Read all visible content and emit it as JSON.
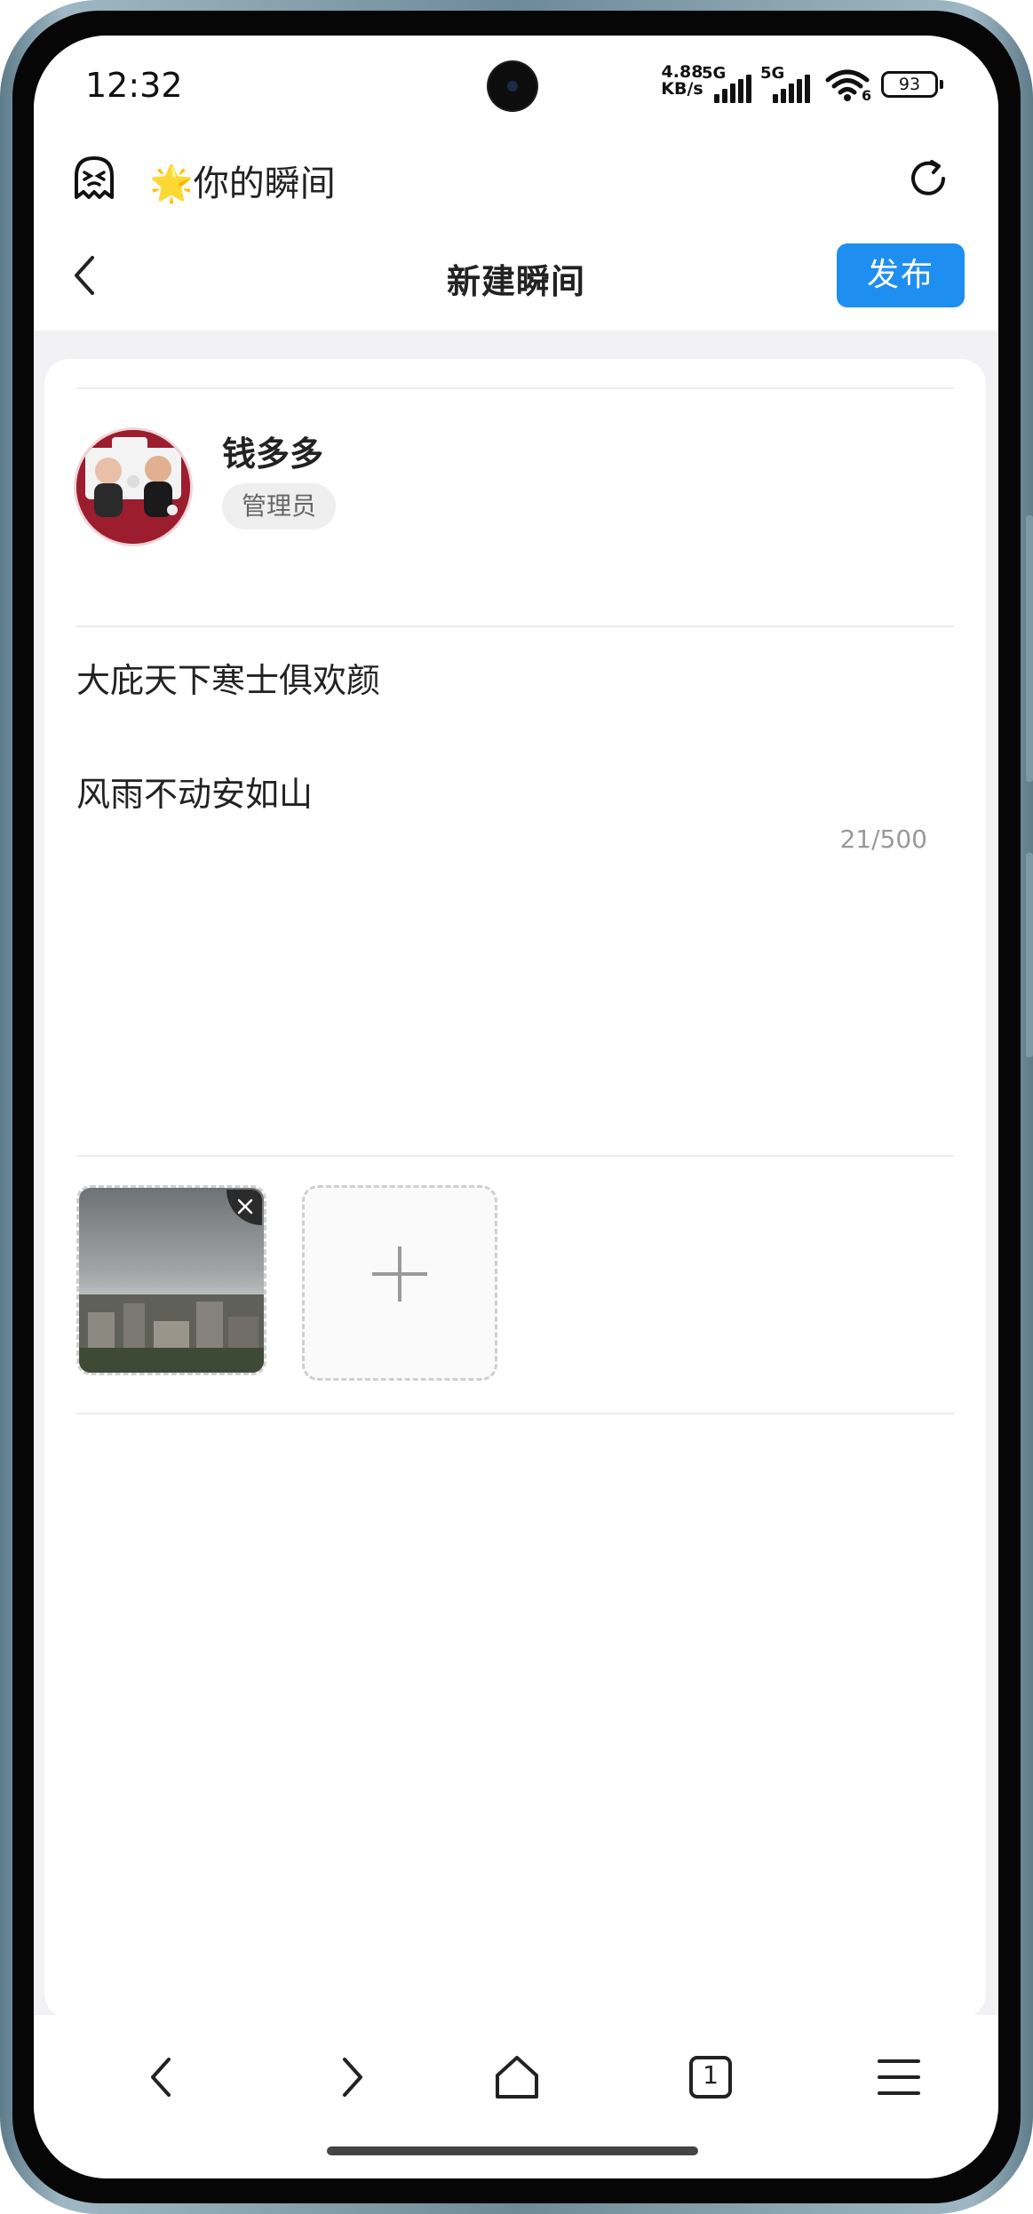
{
  "status_bar": {
    "time": "12:32",
    "net_speed_value": "4.88",
    "net_speed_unit": "KB/s",
    "signal_1_label": "5G",
    "signal_2_label": "5G",
    "wifi_badge": "6",
    "battery": "93"
  },
  "browser": {
    "site_title": "🌟你的瞬间",
    "icons": [
      "ghost-icon",
      "refresh-icon"
    ]
  },
  "header": {
    "title": "新建瞬间",
    "publish_label": "发布"
  },
  "user": {
    "name": "钱多多",
    "role": "管理员"
  },
  "post": {
    "lines": [
      "大庇天下寒士俱欢颜",
      "风雨不动安如山"
    ],
    "char_count": "21/500"
  },
  "bottom_nav": {
    "items": [
      "back-icon",
      "forward-icon",
      "home-icon",
      "tabs-icon",
      "menu-icon"
    ],
    "tab_count": "1"
  },
  "colors": {
    "accent": "#1f8ef1",
    "avatar_background": "#9b1d2e"
  }
}
